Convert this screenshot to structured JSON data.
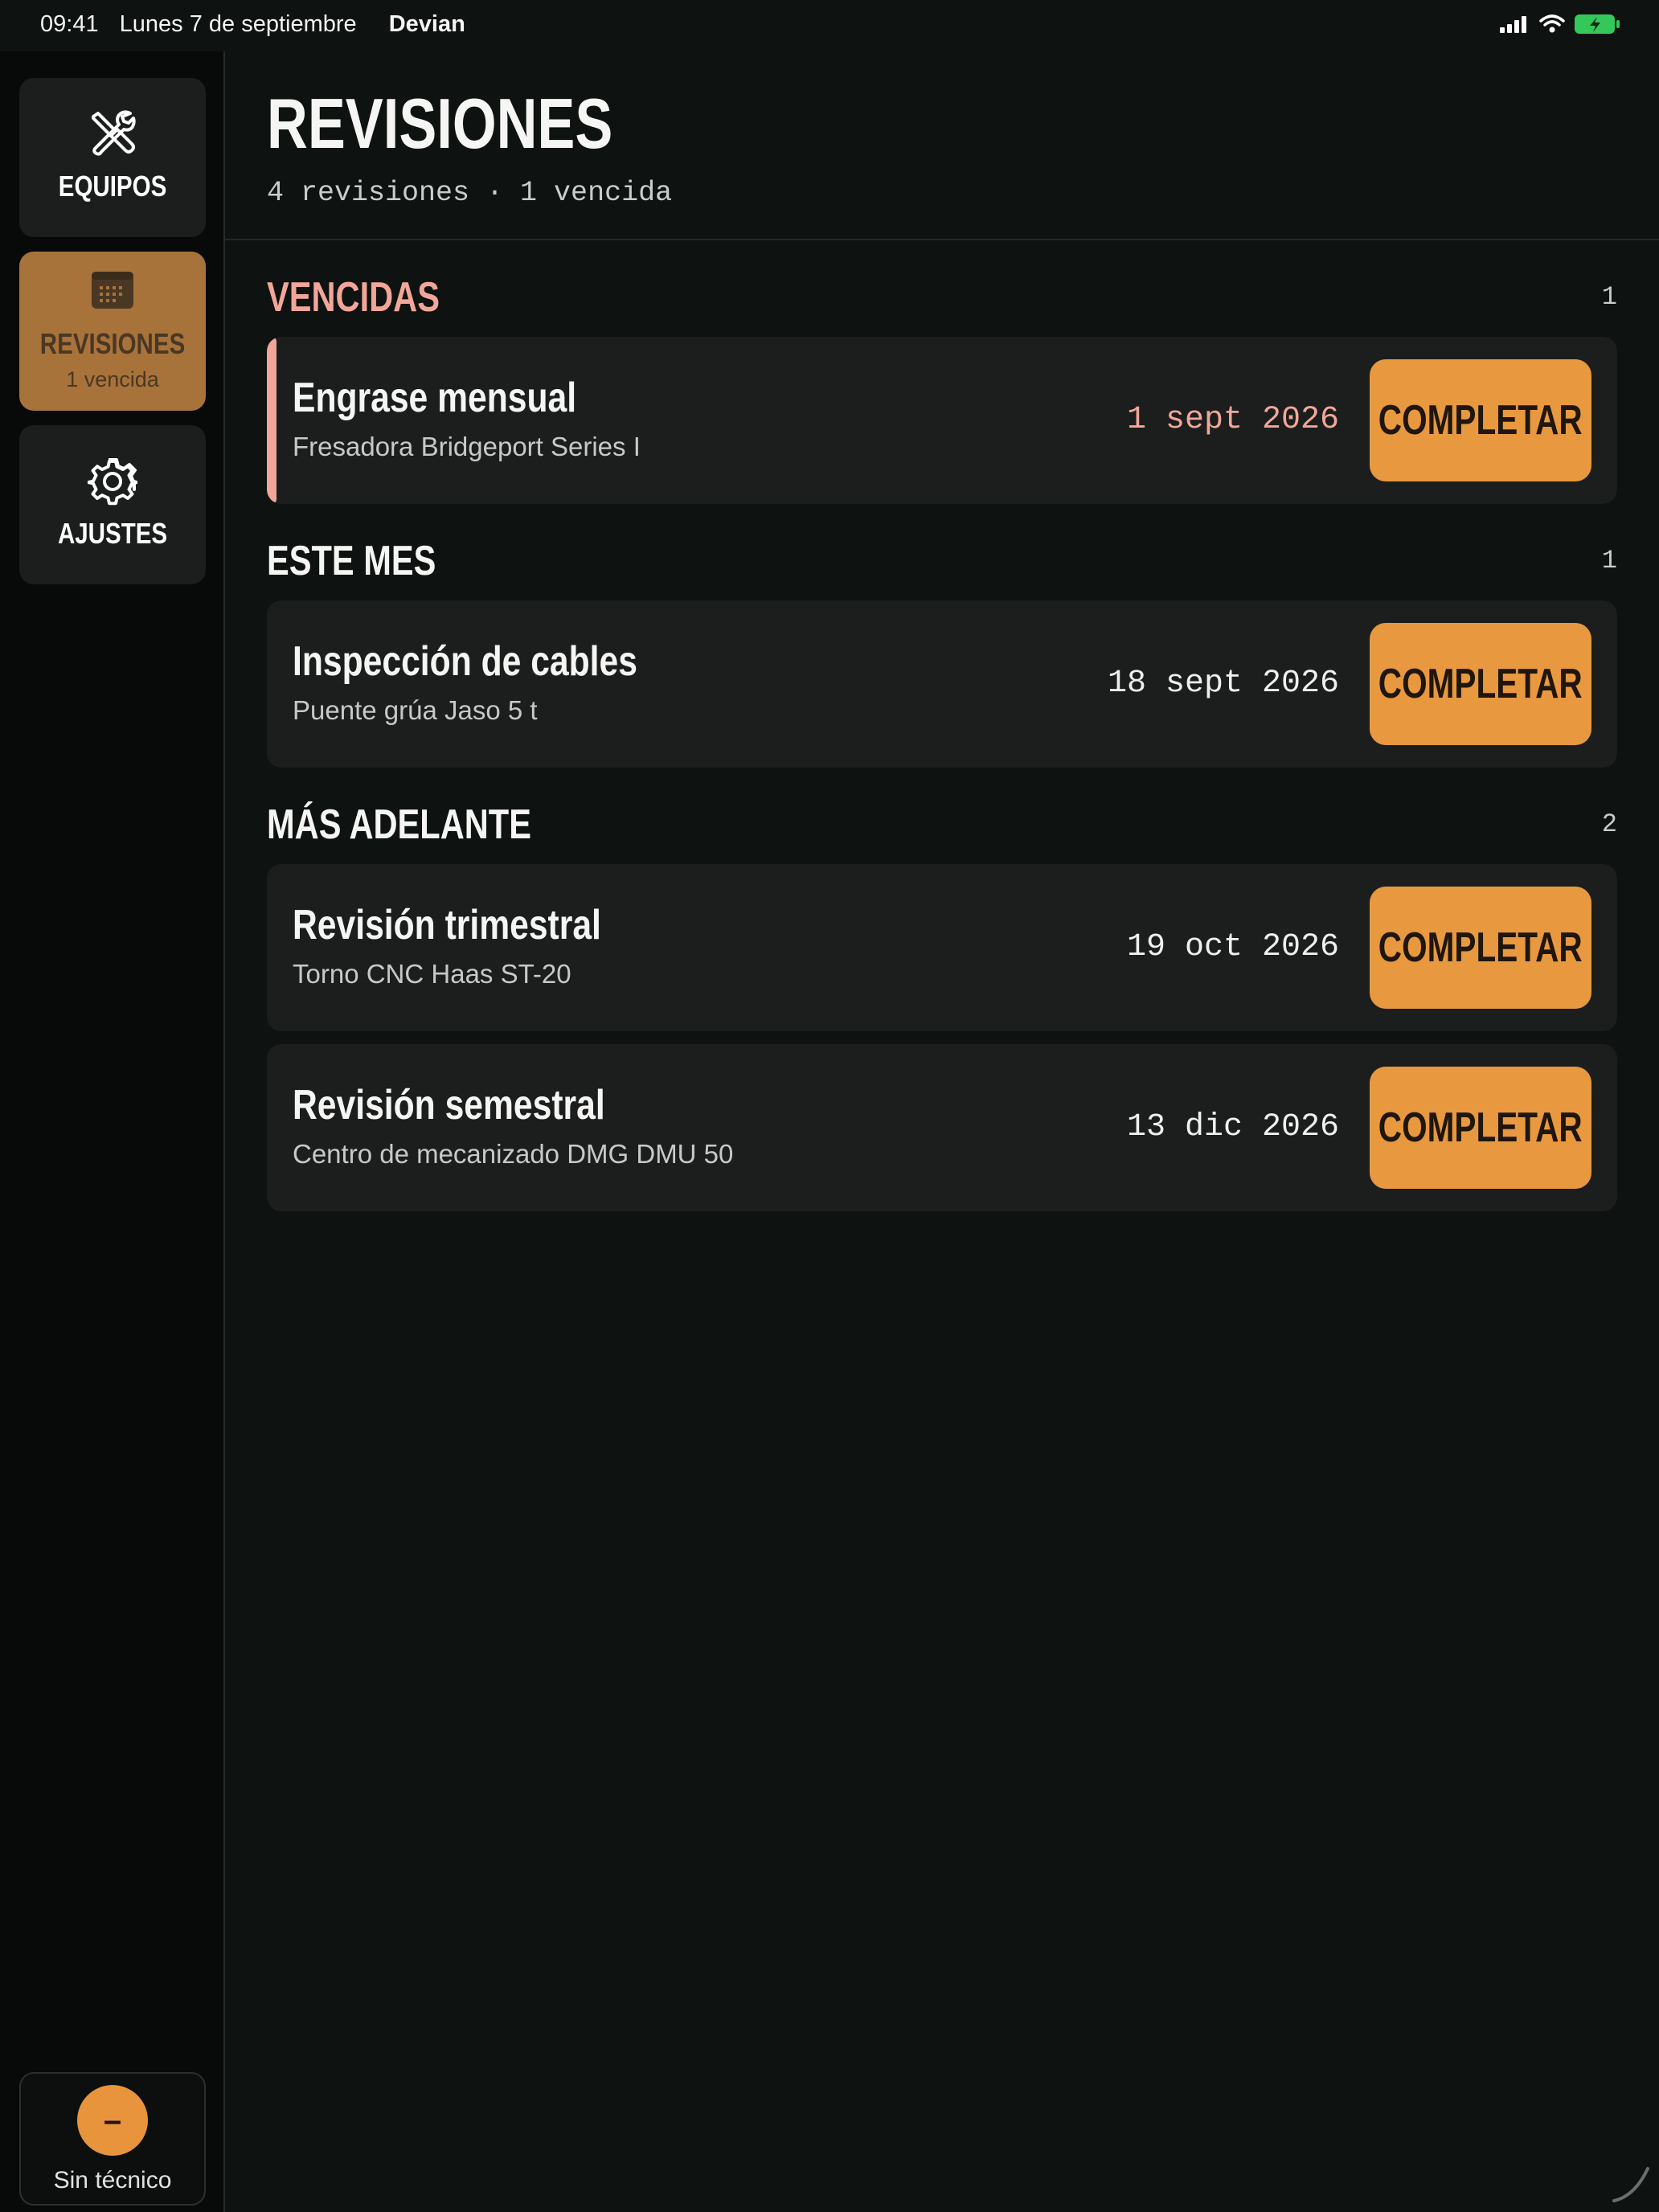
{
  "status_bar": {
    "time": "09:41",
    "date": "Lunes 7 de septiembre",
    "app": "Devian",
    "icons": [
      "signal-icon",
      "wifi-icon",
      "battery-charging-icon"
    ]
  },
  "sidebar": {
    "items": [
      {
        "label": "EQUIPOS",
        "icon": "tools-icon",
        "active": false
      },
      {
        "label": "REVISIONES",
        "icon": "calendar-icon",
        "active": true,
        "sub": "1 vencida"
      },
      {
        "label": "AJUSTES",
        "icon": "gear-icon",
        "active": false
      }
    ],
    "technician": {
      "avatar": "–",
      "label": "Sin técnico"
    }
  },
  "header": {
    "title": "REVISIONES",
    "subtitle": "4 revisiones · 1 vencida"
  },
  "sections": [
    {
      "title": "VENCIDAS",
      "count": "1",
      "color": "#f2a699",
      "items": [
        {
          "title": "Engrase mensual",
          "equipment": "Fresadora Bridgeport Series I",
          "date": "1 sept 2026",
          "overdue": true,
          "action": "COMPLETAR"
        }
      ]
    },
    {
      "title": "ESTE MES",
      "count": "1",
      "color": "#f5f6f4",
      "items": [
        {
          "title": "Inspección de cables",
          "equipment": "Puente grúa Jaso 5 t",
          "date": "18 sept 2026",
          "overdue": false,
          "action": "COMPLETAR"
        }
      ]
    },
    {
      "title": "MÁS ADELANTE",
      "count": "2",
      "color": "#f5f6f4",
      "items": [
        {
          "title": "Revisión trimestral",
          "equipment": "Torno CNC Haas ST-20",
          "date": "19 oct 2026",
          "overdue": false,
          "action": "COMPLETAR"
        },
        {
          "title": "Revisión semestral",
          "equipment": "Centro de mecanizado DMG DMU 50",
          "date": "13 dic 2026",
          "overdue": false,
          "action": "COMPLETAR"
        }
      ]
    }
  ],
  "colors": {
    "accent": "#e8983f",
    "overdue": "#f2a699",
    "background": "#0e1210",
    "card": "#1b1e1d",
    "sidebar_active": "#a8733a"
  }
}
